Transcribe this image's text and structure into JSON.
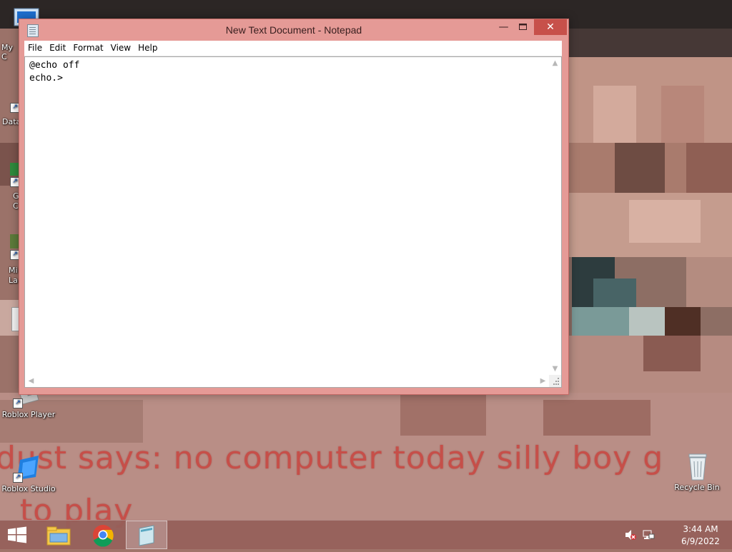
{
  "window": {
    "title": "New Text Document - Notepad",
    "controls": {
      "minimize": "—",
      "maximize": "☐",
      "close": "✕"
    }
  },
  "menu": [
    "File",
    "Edit",
    "Format",
    "View",
    "Help"
  ],
  "editor": {
    "lines": [
      "@echo off",
      "echo.>"
    ]
  },
  "desktop": {
    "icons": {
      "my_computer": "My C",
      "data": "Data",
      "google_chrome_1": "G",
      "google_chrome_2": "C",
      "minecraft_1": "Mi",
      "minecraft_2": "La",
      "roblox_player": "Roblox Player",
      "roblox_studio": "Roblox Studio",
      "recycle_bin": "Recycle Bin"
    },
    "wallpaper_caption_line1": "dust says: no computer today silly boy g",
    "wallpaper_caption_line2": "to play"
  },
  "taskbar": {
    "time": "3:44 AM",
    "date": "6/9/2022",
    "pinned": [
      "start",
      "file-explorer",
      "google-chrome",
      "notepad"
    ]
  },
  "colors": {
    "window_frame": "#e59a96",
    "close_button": "#c7504a",
    "taskbar": "#965f5a",
    "caption_text": "#c9453f"
  }
}
